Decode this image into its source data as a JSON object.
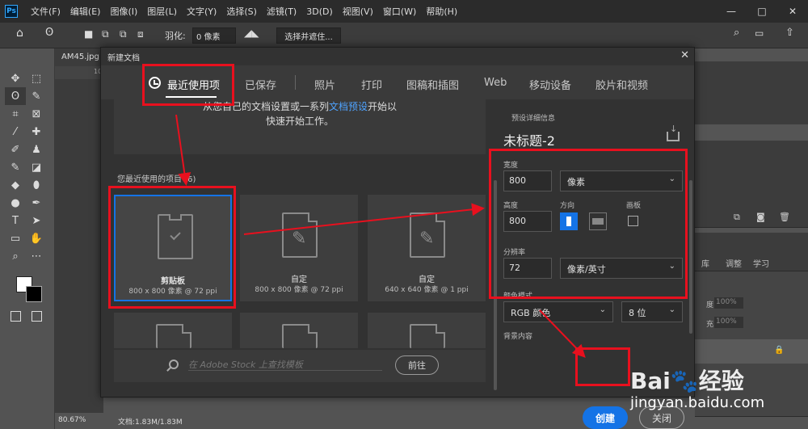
{
  "app": {
    "logo": "Ps"
  },
  "menu": [
    "文件(F)",
    "编辑(E)",
    "图像(I)",
    "图层(L)",
    "文字(Y)",
    "选择(S)",
    "滤镜(T)",
    "3D(D)",
    "视图(V)",
    "窗口(W)",
    "帮助(H)"
  ],
  "window_controls": {
    "minimize": "—",
    "maximize": "□",
    "close": "✕"
  },
  "options_bar": {
    "feather_label": "羽化:",
    "feather_value": "0 像素",
    "select_mask_button": "选择并遮住..."
  },
  "doc_tab": "AM45.jpg",
  "ruler_mark": "10",
  "status": {
    "zoom": "80.67%",
    "doc_size": "文档:1.83M/1.83M"
  },
  "dialog": {
    "title": "新建文档",
    "close": "✕",
    "tabs": [
      "最近使用项",
      "已保存",
      "照片",
      "打印",
      "图稿和插图",
      "Web",
      "移动设备",
      "胶片和视频"
    ],
    "intro_line1_prefix": "从您自己的文档设置或一系列",
    "intro_link": "文档预设",
    "intro_line1_suffix": "开始以",
    "intro_line2": "快速开始工作。",
    "recent_label": "您最近使用的项目  (6)",
    "cards": [
      {
        "name": "剪贴板",
        "size": "800 x 800 像素 @ 72 ppi"
      },
      {
        "name": "自定",
        "size": "800 x 800 像素 @ 72 ppi"
      },
      {
        "name": "自定",
        "size": "640 x 640 像素 @ 1 ppi"
      }
    ],
    "stock_placeholder": "在 Adobe Stock 上查找模板",
    "go_button": "前往",
    "preset": {
      "section_title": "预设详细信息",
      "doc_name": "未标题-2",
      "width_label": "宽度",
      "width_value": "800",
      "width_unit": "像素",
      "height_label": "高度",
      "height_value": "800",
      "orientation_label": "方向",
      "artboard_label": "画板",
      "resolution_label": "分辨率",
      "resolution_value": "72",
      "resolution_unit": "像素/英寸",
      "color_mode_label": "颜色模式",
      "color_mode_value": "RGB 颜色",
      "bit_depth": "8 位",
      "background_label": "背景内容"
    },
    "create_button": "创建",
    "close_button": "关闭"
  },
  "right_panel": {
    "tabs": [
      "库",
      "调整",
      "学习"
    ],
    "opacity_label": "度:",
    "opacity_value": "100%",
    "fill_label": "充:",
    "fill_value": "100%"
  },
  "watermark": {
    "brand": "Bai🐾经验",
    "url": "jingyan.baidu.com"
  },
  "colors": {
    "accent": "#1473e6",
    "annotation": "#e8101e",
    "link": "#4fa3ff"
  }
}
